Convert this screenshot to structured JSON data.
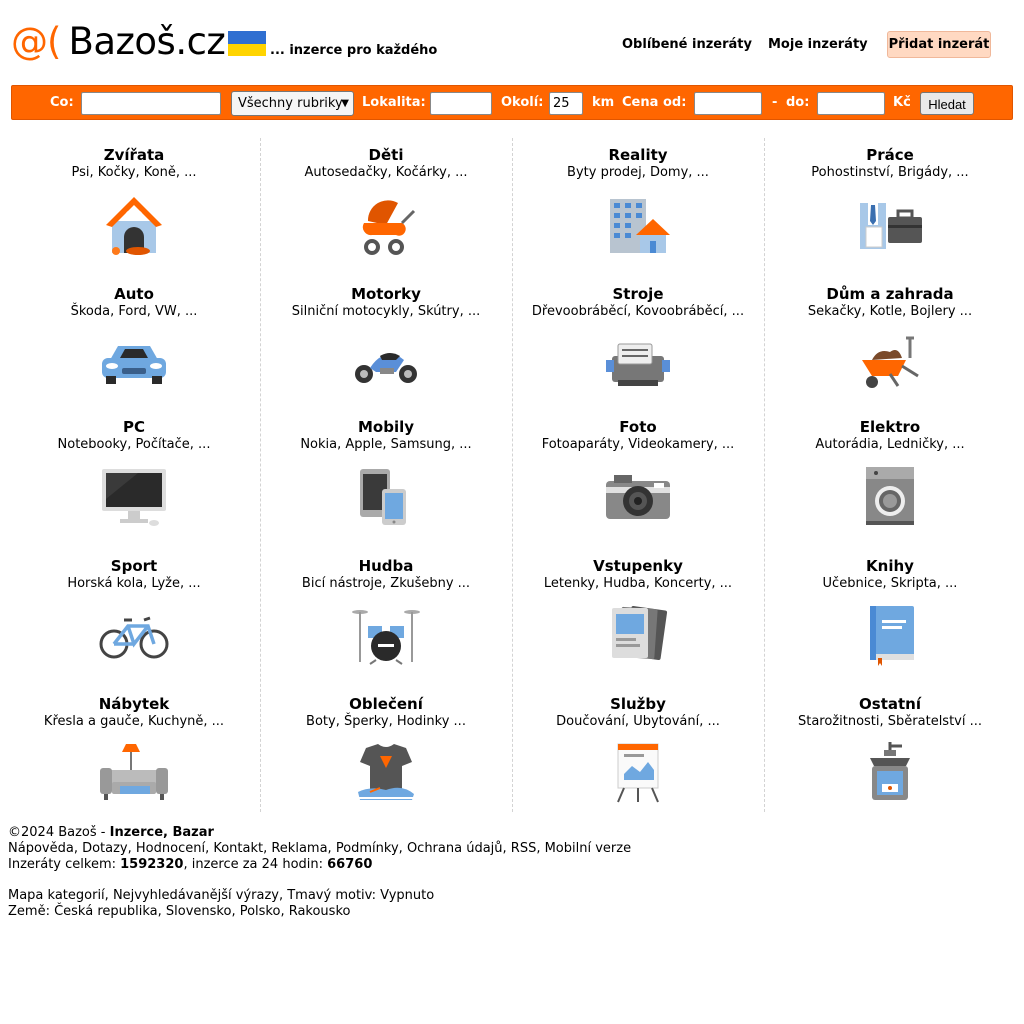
{
  "header": {
    "logo_at": "@(",
    "logo_name": "Bazoš.cz",
    "tagline": "... inzerce pro každého",
    "flag_colors": [
      "#2f6fd1",
      "#ffd400"
    ],
    "links": {
      "favorites": "Oblíbené inzeráty",
      "my_ads": "Moje inzeráty",
      "add_ad": "Přidat inzerát"
    }
  },
  "search": {
    "co_label": "Co:",
    "co_value": "",
    "category_selected": "Všechny rubriky",
    "lokalita_label": "Lokalita:",
    "lokalita_value": "",
    "okoli_label": "Okolí:",
    "okoli_value": "25",
    "km_label": "km",
    "cena_label": "Cena",
    "od_label": "od:",
    "od_value": "",
    "dash": "-",
    "do_label": "do:",
    "do_value": "",
    "currency": "Kč",
    "button": "Hledat"
  },
  "categories": [
    {
      "title": "Zvířata",
      "sub": "Psi, Kočky, Koně, ...",
      "icon": "doghouse-icon"
    },
    {
      "title": "Děti",
      "sub": "Autosedačky, Kočárky, ...",
      "icon": "stroller-icon"
    },
    {
      "title": "Reality",
      "sub": "Byty prodej, Domy, ...",
      "icon": "building-icon"
    },
    {
      "title": "Práce",
      "sub": "Pohostinství, Brigády, ...",
      "icon": "briefcase-icon"
    },
    {
      "title": "Auto",
      "sub": "Škoda, Ford, VW, ...",
      "icon": "car-icon"
    },
    {
      "title": "Motorky",
      "sub": "Silniční motocykly, Skútry, ...",
      "icon": "motorcycle-icon"
    },
    {
      "title": "Stroje",
      "sub": "Dřevoobráběcí, Kovoobráběcí, ...",
      "icon": "machine-icon"
    },
    {
      "title": "Dům a zahrada",
      "sub": "Sekačky, Kotle, Bojlery ...",
      "icon": "wheelbarrow-icon"
    },
    {
      "title": "PC",
      "sub": "Notebooky, Počítače, ...",
      "icon": "monitor-icon"
    },
    {
      "title": "Mobily",
      "sub": "Nokia, Apple, Samsung, ...",
      "icon": "phone-icon"
    },
    {
      "title": "Foto",
      "sub": "Fotoaparáty, Videokamery, ...",
      "icon": "camera-icon"
    },
    {
      "title": "Elektro",
      "sub": "Autorádia, Ledničky, ...",
      "icon": "washing-machine-icon"
    },
    {
      "title": "Sport",
      "sub": "Horská kola, Lyže, ...",
      "icon": "bicycle-icon"
    },
    {
      "title": "Hudba",
      "sub": "Bicí nástroje, Zkušebny ...",
      "icon": "drums-icon"
    },
    {
      "title": "Vstupenky",
      "sub": "Letenky, Hudba, Koncerty, ...",
      "icon": "tickets-icon"
    },
    {
      "title": "Knihy",
      "sub": "Učebnice, Skripta, ...",
      "icon": "book-icon"
    },
    {
      "title": "Nábytek",
      "sub": "Křesla a gauče, Kuchyně, ...",
      "icon": "sofa-icon"
    },
    {
      "title": "Oblečení",
      "sub": "Boty, Šperky, Hodinky ...",
      "icon": "tshirt-icon"
    },
    {
      "title": "Služby",
      "sub": "Doučování, Ubytování, ...",
      "icon": "presentation-icon"
    },
    {
      "title": "Ostatní",
      "sub": "Starožitnosti, Sběratelství ...",
      "icon": "grinder-icon"
    }
  ],
  "footer": {
    "copyright": "©2024 Bazoš - ",
    "copyright_bold": "Inzerce, Bazar",
    "links": [
      "Nápověda",
      "Dotazy",
      "Hodnocení",
      "Kontakt",
      "Reklama",
      "Podmínky",
      "Ochrana údajů",
      "RSS",
      "Mobilní verze"
    ],
    "total_label": "Inzeráty celkem: ",
    "total_value": "1592320",
    "day_label": ", inzerce za 24 hodin: ",
    "day_value": "66760",
    "line4_links": [
      "Mapa kategorií",
      "Nejvyhledávanější výrazy"
    ],
    "dark_label": "Tmavý motiv: ",
    "dark_value": "Vypnuto",
    "countries_label": "Země: ",
    "countries": [
      "Česká republika",
      "Slovensko",
      "Polsko",
      "Rakousko"
    ]
  }
}
